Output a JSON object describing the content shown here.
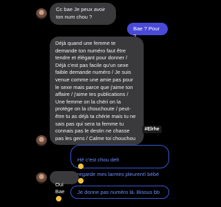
{
  "messages": [
    {
      "id": "m1",
      "sender": "contact",
      "text": "Cc bae Je peux avoir ton num chou ?"
    },
    {
      "id": "m2",
      "sender": "me",
      "text": "Bae ? Pour ?"
    },
    {
      "id": "m3",
      "sender": "contact",
      "text": "Déjà quand une femme te demande ton numéro faut être tendre et élégant pour donner / Déjà c'est pas facile qu'un sexe faible demande numéro / Je suis venue comme une amie pas pour le sexe mais parce que j'aime ton affaire / j'aime tes publications / Une femme on la chéri on la protège on la chouchoute / peut-être tu as déjà ta chérie mais tu ne sais pas qui sera ta femme tu connais pas le destin ne chasse pas les gens / Calme toi chouchou"
    },
    {
      "id": "m4",
      "sender": "me",
      "text_before_emoji": "Hé c'est chou deh",
      "text_after_emoji": " regarde mes larmes pleurent! bébé",
      "emoji_icon": "tears-of-joy-emoji",
      "emoji2_icon": "smiling-emoji"
    },
    {
      "id": "m5",
      "sender": "contact",
      "text": "Oui Bae",
      "emoji_icon": "tears-of-joy-emoji"
    },
    {
      "id": "m6",
      "sender": "me",
      "text": "Je donne pas numéro là. Bisous bb"
    }
  ],
  "watermark": "#Elrhe",
  "colors": {
    "background": "#000000",
    "incoming_bubble": "#3a3a3c",
    "outgoing_bubble": "#4a4ad8",
    "outline_bubble_border": "#3b5bd9",
    "outline_bubble_text": "#6e8cff"
  }
}
